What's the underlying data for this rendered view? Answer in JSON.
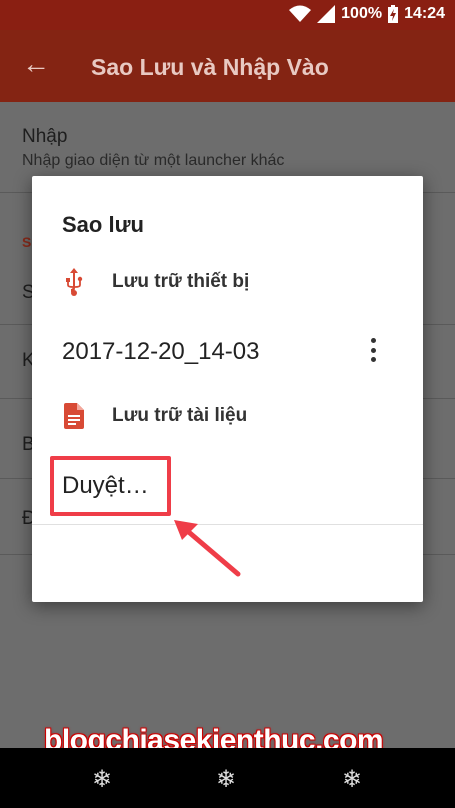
{
  "status_bar": {
    "battery": "100%",
    "time": "14:24"
  },
  "appbar": {
    "title": "Sao Lưu và Nhập Vào"
  },
  "settings": {
    "import_title": "Nhập",
    "import_subtitle": "Nhập giao diện từ một launcher khác",
    "section_letter": "S",
    "row2_letter": "S",
    "row3_letter": "K",
    "row4_letter": "B",
    "row5_letter": "Đ"
  },
  "dialog": {
    "title": "Sao lưu",
    "device_storage": "Lưu trữ thiết bị",
    "backup_file": "2017-12-20_14-03",
    "document_storage": "Lưu trữ tài liệu",
    "browse": "Duyệt…"
  },
  "watermark": "blogchiasekienthuc.com",
  "colors": {
    "accent": "#d84a35",
    "highlight": "#ef3d48",
    "appbar": "#842413"
  }
}
